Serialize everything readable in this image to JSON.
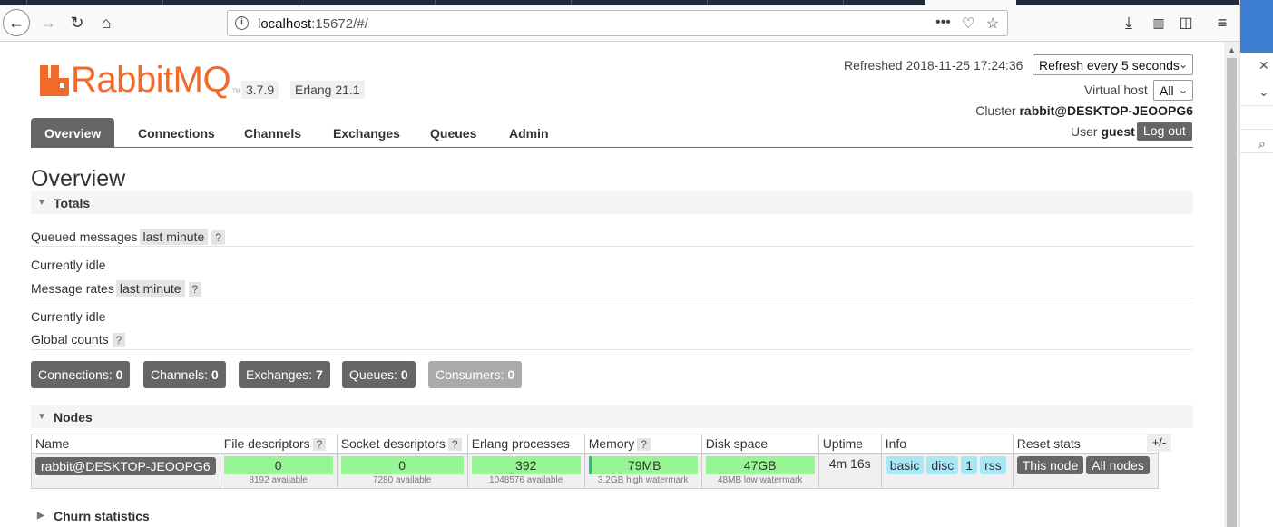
{
  "browser": {
    "url_host": "localhost",
    "url_rest": ":15672/#/"
  },
  "header": {
    "brand": "RabbitMQ",
    "brand_tm": "TM",
    "version": "3.7.9",
    "erlang": "Erlang 21.1",
    "refreshed_label": "Refreshed 2018-11-25 17:24:36",
    "refresh_select": "Refresh every 5 seconds",
    "vhost_label": "Virtual host",
    "vhost_select": "All",
    "cluster_label": "Cluster",
    "cluster_name": "rabbit@DESKTOP-JEOOPG6",
    "user_label": "User",
    "user_name": "guest",
    "logout": "Log out"
  },
  "tabs": [
    "Overview",
    "Connections",
    "Channels",
    "Exchanges",
    "Queues",
    "Admin"
  ],
  "page_title": "Overview",
  "totals": {
    "heading": "Totals",
    "queued_label": "Queued messages",
    "queued_chip": "last minute",
    "help": "?",
    "idle1": "Currently idle",
    "rates_label": "Message rates",
    "rates_chip": "last minute",
    "idle2": "Currently idle",
    "global_label": "Global counts"
  },
  "counts": [
    {
      "label": "Connections:",
      "value": "0"
    },
    {
      "label": "Channels:",
      "value": "0"
    },
    {
      "label": "Exchanges:",
      "value": "7"
    },
    {
      "label": "Queues:",
      "value": "0"
    },
    {
      "label": "Consumers:",
      "value": "0"
    }
  ],
  "nodes": {
    "heading": "Nodes",
    "columns": [
      "Name",
      "File descriptors",
      "Socket descriptors",
      "Erlang processes",
      "Memory",
      "Disk space",
      "Uptime",
      "Info",
      "Reset stats"
    ],
    "plusminus": "+/-",
    "row": {
      "name": "rabbit@DESKTOP-JEOOPG6",
      "file_desc": "0",
      "file_desc_sub": "8192 available",
      "socket_desc": "0",
      "socket_desc_sub": "7280 available",
      "erlang_proc": "392",
      "erlang_proc_sub": "1048576 available",
      "memory": "79MB",
      "memory_sub": "3.2GB high watermark",
      "disk": "47GB",
      "disk_sub": "48MB low watermark",
      "uptime": "4m 16s",
      "info": [
        "basic",
        "disc",
        "1",
        "rss"
      ],
      "reset": [
        "This node",
        "All nodes"
      ]
    }
  },
  "churn": {
    "heading": "Churn statistics"
  },
  "colors": {
    "brand": "#f26a2a",
    "tab_active": "#666666",
    "bar_green": "#98f595",
    "pill_blue": "#a8e7f6"
  }
}
